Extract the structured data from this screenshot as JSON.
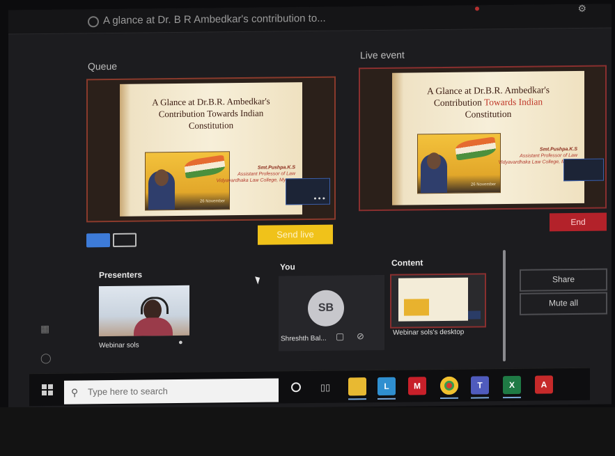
{
  "window": {
    "title": "A glance at Dr. B R Ambedkar's contribution to..."
  },
  "queue": {
    "label": "Queue",
    "slide": {
      "title_line1": "A Glance at Dr.B.R. Ambedkar's",
      "title_line2": "Contribution Towards Indian",
      "title_line3": "Constitution",
      "image_caption": "26 November",
      "author_name": "Smt.Pushpa.K.S",
      "author_role": "Assistant Professor of Law",
      "author_org": "Vidyavardhaka Law College, Mysuru"
    }
  },
  "live": {
    "label": "Live event",
    "slide": {
      "title_line1": "A Glance at Dr.B.R. Ambedkar's",
      "title_line2": "Contribution",
      "title_line2_highlight": "Towards Indian",
      "title_line3": "Constitution",
      "image_caption": "26 November",
      "author_name": "Smt.Pushpa.K.S",
      "author_role": "Assistant Professor of Law",
      "author_org": "Vidyavardhaka Law College, Mysuru"
    }
  },
  "controls": {
    "send_live": "Send live",
    "end": "End",
    "share": "Share",
    "mute_all": "Mute all"
  },
  "presenters": {
    "label": "Presenters",
    "name": "Webinar sols"
  },
  "you": {
    "label": "You",
    "initials": "SB",
    "name": "Shreshth Bal..."
  },
  "content": {
    "label": "Content",
    "name": "Webinar sols's desktop"
  },
  "taskbar": {
    "search_placeholder": "Type here to search",
    "icons": [
      "file-explorer-icon",
      "app-l-icon",
      "mcafee-icon",
      "chrome-icon",
      "teams-icon",
      "excel-icon",
      "pdf-icon"
    ]
  },
  "colors": {
    "send_live": "#f0c21a",
    "end": "#b3222a",
    "frame": "#8a3a2c",
    "toggle_active": "#3d7bd8"
  }
}
